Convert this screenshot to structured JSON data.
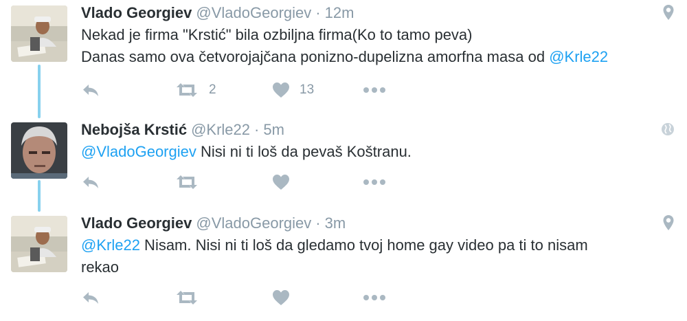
{
  "tweets": [
    {
      "name": "Vlado Georgiev",
      "handle": "@VladoGeorgiev",
      "dot": "·",
      "time": "12m",
      "line1": "Nekad je firma \"Krstić\" bila ozbiljna firma(Ko to tamo peva)",
      "line2_text": "Danas samo ova četvorojajčana ponizno-dupelizna amorfna masa od ",
      "line2_mention": "@Krle22",
      "retweets": "2",
      "likes": "13",
      "corner_icon": "location-pin-icon"
    },
    {
      "name": "Nebojša Krstić",
      "handle": "@Krle22",
      "dot": "·",
      "time": "5m",
      "mention": "@VladoGeorgiev",
      "text": " Nisi ni ti loš da pevaš Koštranu.",
      "retweets": "",
      "likes": "",
      "corner_icon": "globe-icon"
    },
    {
      "name": "Vlado Georgiev",
      "handle": "@VladoGeorgiev",
      "dot": "·",
      "time": "3m",
      "mention": "@Krle22",
      "text_line1": " Nisam. Nisi ni ti loš da gledamo tvoj home gay video pa ti to nisam",
      "text_line2": "rekao",
      "retweets": "",
      "likes": "",
      "corner_icon": "location-pin-icon"
    }
  ],
  "colors": {
    "name": "#292f33",
    "meta": "#8899a6",
    "mention": "#1da1f2",
    "action_icon": "#aab8c2",
    "thread_line": "#87d1ee"
  },
  "icons": [
    "reply-icon",
    "retweet-icon",
    "heart-icon",
    "more-icon",
    "location-pin-icon",
    "globe-icon"
  ]
}
